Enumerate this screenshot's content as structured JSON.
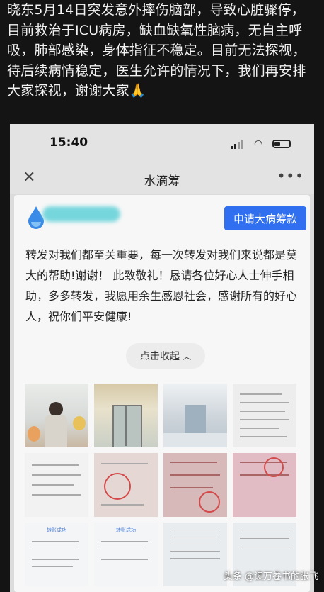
{
  "caption": "晓东5月14日突发意外摔伤脑部，导致心脏骤停，目前救治于ICU病房，缺血缺氧性脑病，无自主呼吸，肺部感染，身体指征不稳定。目前无法探视，待后续病情稳定，医生允许的情况下，我们再安排大家探视，谢谢大家🙏",
  "status_bar": {
    "time": "15:40"
  },
  "navbar": {
    "title": "水滴筹",
    "close_icon": "close-icon",
    "more_icon": "more-icon"
  },
  "card": {
    "apply_button": "申请大病筹款",
    "story": "转发对我们都至关重要，每一次转发对我们来说都是莫大的帮助!谢谢！ 此致敬礼！恳请各位好心人士伸手相助，多多转发，我愿用余生感恩社会，感谢所有的好心人，祝你们平安健康!",
    "collapse_label": "点击收起",
    "transfer_title": "转账成功"
  },
  "watermark": "头条 @读万卷书的张飞"
}
